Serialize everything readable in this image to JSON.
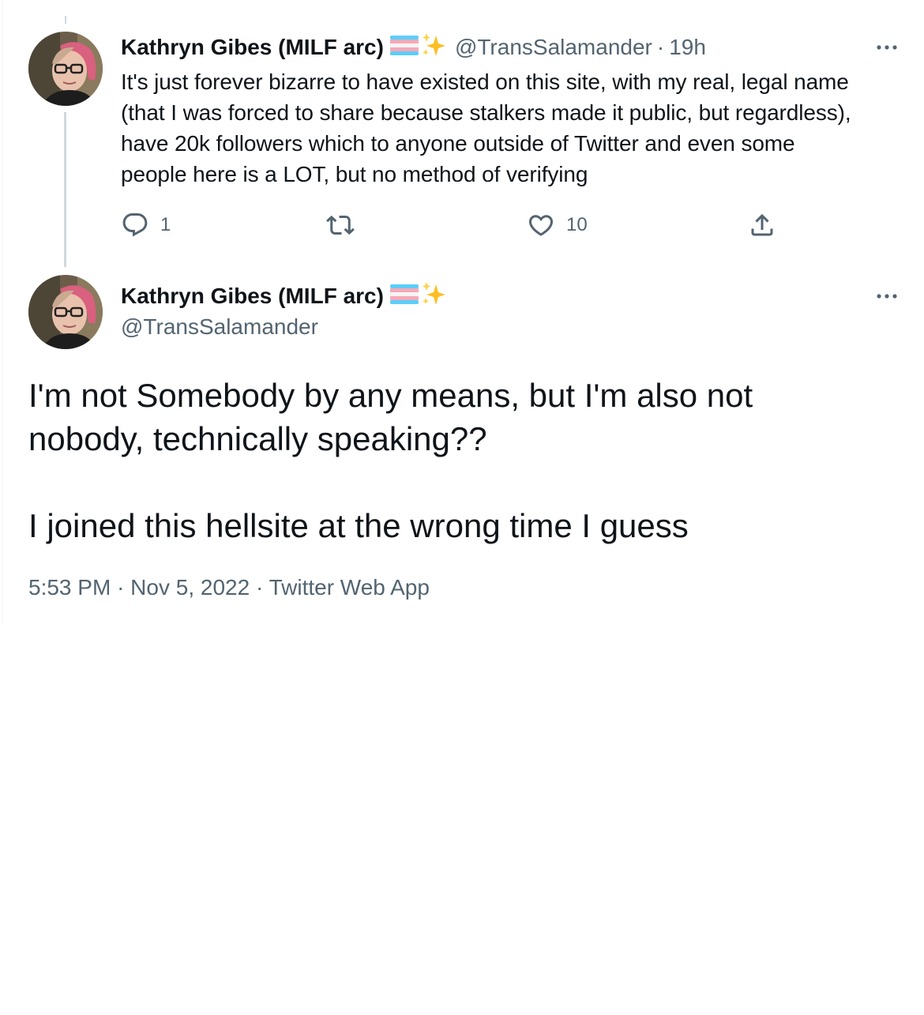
{
  "reply_tweet": {
    "author_name": "Kathryn Gibes (MILF arc)",
    "handle": "@TransSalamander",
    "separator": "·",
    "time_ago": "19h",
    "text": "It's just forever bizarre to have existed on this site, with my real, legal name\n(that I was forced to share because stalkers made it public, but regardless),\nhave 20k followers which to anyone outside of Twitter and even some\npeople here is a LOT, but no method of verifying",
    "actions": {
      "reply_count": "1",
      "retweet_count": "",
      "like_count": "10"
    },
    "icons": [
      "transgender-flag-emoji",
      "sparkles-emoji",
      "more-icon",
      "reply-icon",
      "retweet-icon",
      "like-icon",
      "share-icon"
    ]
  },
  "main_tweet": {
    "author_name": "Kathryn Gibes (MILF arc)",
    "handle": "@TransSalamander",
    "text": "I'm not Somebody by any means, but I'm also not\nnobody, technically speaking??\n\nI joined this hellsite at the wrong time I guess",
    "time": "5:53 PM",
    "date": "Nov 5, 2022",
    "source": "Twitter Web App",
    "separator": "·"
  },
  "colors": {
    "text_primary": "#0f1419",
    "text_secondary": "#536471",
    "thread_line": "#cfd9de",
    "flag_blue": "#5bcefa",
    "flag_pink": "#f5a9b8",
    "sparkle": "#fbbf24"
  }
}
